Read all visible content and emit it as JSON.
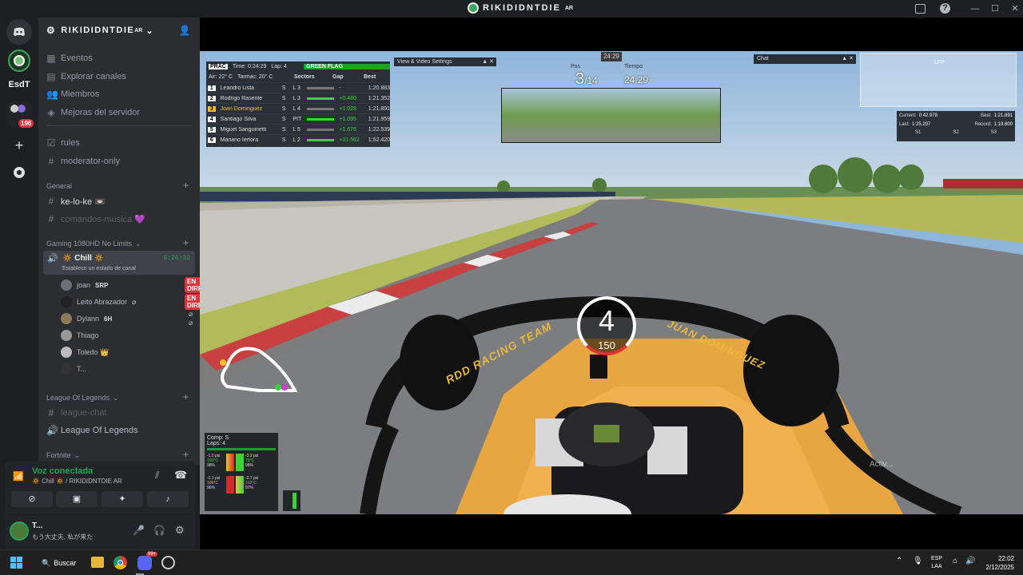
{
  "window": {
    "title": "RIKIDIDNTDIE",
    "title_suffix": "AR"
  },
  "server_bar": {
    "esdt_label": "EsdT",
    "badge": "196"
  },
  "server": {
    "name": "RIKIDIDNTDIE",
    "suffix": "AR"
  },
  "top_items": [
    {
      "label": "Eventos",
      "icon": "calendar-icon"
    },
    {
      "label": "Explorar canales",
      "icon": "browse-icon"
    },
    {
      "label": "Miembros",
      "icon": "members-icon"
    },
    {
      "label": "Mejoras del servidor",
      "icon": "boost-icon"
    }
  ],
  "channels_top": [
    {
      "label": "rules",
      "icon": "rules-icon"
    },
    {
      "label": "moderator-only",
      "icon": "hash-icon"
    }
  ],
  "categories": {
    "general": "General",
    "gaming": "Gaming 1080HD No Limits",
    "lol": "League Of Legends",
    "fortnite": "Fortnite"
  },
  "general_channels": [
    {
      "label": "ke-lo-ke 📼"
    },
    {
      "label": "comandos-musica 💜"
    }
  ],
  "voice_channel": {
    "name": "🔅 Chill 🔅",
    "time": "5:26:32",
    "status": "Establece un estado de canal"
  },
  "voice_users": [
    {
      "name": "joan",
      "tag": "SRP",
      "live": "EN DIRECTO"
    },
    {
      "name": "Leito Abrazador",
      "tag": "",
      "live": "EN DIRECTO"
    },
    {
      "name": "Dylann",
      "tag": "6H",
      "live": ""
    },
    {
      "name": "Thiago",
      "tag": "",
      "live": ""
    },
    {
      "name": "Toledo 👑",
      "tag": "",
      "live": ""
    },
    {
      "name": "T...",
      "tag": "",
      "live": ""
    }
  ],
  "lol_channels": [
    {
      "label": "league-chat"
    },
    {
      "label": "League Of Legends"
    }
  ],
  "voice_panel": {
    "status": "Voz conectada",
    "location": "🔅 Chill 🔅 / RIKIDIDNTDIE AR"
  },
  "user_panel": {
    "name": "T...",
    "status": "もう大丈夫, 私が来た"
  },
  "game": {
    "session": "PRAC",
    "time_label": "Time: 0:24:29",
    "laps_label": "Lap: 4",
    "flag": "GREEN FLAG",
    "air": "Air: 22° C",
    "tarmac": "Tarmac: 20° C",
    "cols": [
      "Sectors",
      "Gap",
      "Best"
    ],
    "rows": [
      {
        "pos": "1",
        "name": "Leandro Lista",
        "tyre": "S",
        "lap": "L 3",
        "gap": "-",
        "best": "1:20.883"
      },
      {
        "pos": "2",
        "name": "Rodrigo Rasente",
        "tyre": "S",
        "lap": "L 3",
        "gap": "+0.480",
        "best": "1:21.352"
      },
      {
        "pos": "3",
        "name": "Joan Dominguez",
        "tyre": "S",
        "lap": "L 4",
        "gap": "+1.028",
        "best": "1:21.891"
      },
      {
        "pos": "4",
        "name": "Santiago Silva",
        "tyre": "S",
        "lap": "PIT",
        "gap": "+1.095",
        "best": "1:21.959"
      },
      {
        "pos": "5",
        "name": "Miguel Sanguinetti",
        "tyre": "S",
        "lap": "L 5",
        "gap": "+1.676",
        "best": "1:22.539"
      },
      {
        "pos": "6",
        "name": "Mariano Iertora",
        "tyre": "S",
        "lap": "L 2",
        "gap": "+31.562",
        "best": "1:52.420"
      }
    ],
    "video_settings": "View & Video Settings",
    "clock": "24:29",
    "pos_label": "Pos",
    "pos": "3",
    "pos_total": "/14",
    "tiempo_label": "Tiempo",
    "tiempo": "24:29",
    "chat": "Chat",
    "lfp": "LFP",
    "current_label": "Current:",
    "current": "0:42.978",
    "best_label": "Best:",
    "best": "1:21.891",
    "last_label": "Last:",
    "last": "1:25.207",
    "record_label": "Record:",
    "record": "1:19.800",
    "sectors": [
      "S1",
      "S2",
      "S3"
    ],
    "gear": "4",
    "speed": "150",
    "comp": "Comp: S",
    "laps": "Laps: 4",
    "tyres": [
      {
        "psi": "-1.0 psi",
        "temp": "100°C",
        "wear": "98%"
      },
      {
        "psi": "-3.2 psi",
        "temp": "79°C",
        "wear": "98%"
      },
      {
        "psi": "-1.1 psi",
        "temp": "105°C",
        "wear": "96%"
      },
      {
        "psi": "-0.7 psi",
        "temp": "102°C",
        "wear": "97%"
      }
    ],
    "halo_text": "RDD RACING TEAM",
    "halo_name": "JUAN DOMINGUEZ",
    "watermark": "Activ..."
  },
  "taskbar": {
    "search": "Buscar",
    "lang1": "ESP",
    "lang2": "LAA",
    "time": "22:02",
    "date": "2/12/2025",
    "discord_badge": "99+"
  }
}
